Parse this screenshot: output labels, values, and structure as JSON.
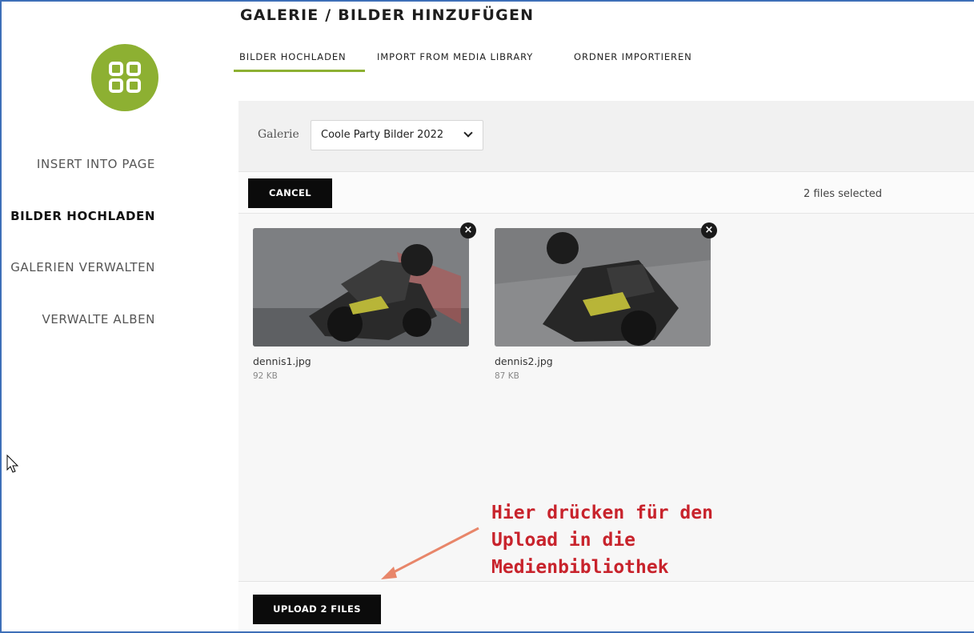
{
  "sidebar": {
    "items": [
      {
        "label": "INSERT INTO PAGE",
        "active": false
      },
      {
        "label": "BILDER HOCHLADEN",
        "active": true
      },
      {
        "label": "GALERIEN VERWALTEN",
        "active": false
      },
      {
        "label": "VERWALTE ALBEN",
        "active": false
      }
    ]
  },
  "header": {
    "title": "GALERIE / BILDER HINZUFÜGEN",
    "tabs": [
      {
        "label": "BILDER HOCHLADEN",
        "active": true
      },
      {
        "label": "IMPORT FROM MEDIA LIBRARY",
        "active": false
      },
      {
        "label": "ORDNER IMPORTIEREN",
        "active": false
      }
    ]
  },
  "gallery": {
    "label": "Galerie",
    "selected": "Coole Party Bilder 2022"
  },
  "uploader": {
    "cancel_label": "CANCEL",
    "files_selected": "2 files selected",
    "files": [
      {
        "name": "dennis1.jpg",
        "size": "92 KB"
      },
      {
        "name": "dennis2.jpg",
        "size": "87 KB"
      }
    ],
    "upload_label": "UPLOAD 2 FILES"
  },
  "annotation": {
    "text": "Hier drücken für den\nUpload in die\nMedienbibliothek"
  },
  "colors": {
    "accent": "#8db032",
    "annotation": "#c8232c",
    "button": "#0b0b0b"
  }
}
